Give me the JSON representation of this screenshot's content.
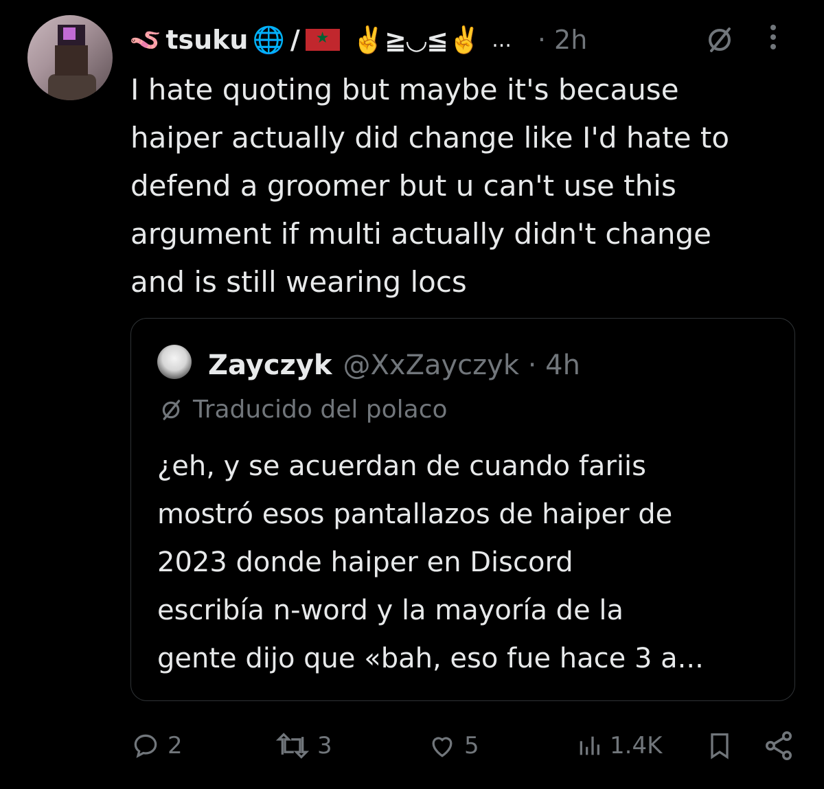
{
  "author": {
    "name_emoji": "🪱",
    "name": "tsuku",
    "globe": "🌐",
    "separator": "/",
    "kaomoji": "✌️≧◡≦✌️",
    "ellipsis": "...",
    "time": "· 2h"
  },
  "tweet": {
    "lines": [
      "I hate quoting but maybe it's because",
      "haiper actually did change like I'd hate to",
      "defend a groomer but u can't use this",
      "argument if multi actually didn't change",
      "and is still wearing locs"
    ]
  },
  "quote": {
    "name": "Zayczyk",
    "handle": "@XxZayczyk · 4h",
    "translated_label": "Traducido del polaco",
    "lines": [
      "¿eh, y se acuerdan de cuando fariis",
      "mostró esos pantallazos de haiper de",
      "2023 donde haiper en Discord",
      "escribía n-word y la mayoría de la",
      "gente dijo que «bah, eso fue hace 3 a..."
    ]
  },
  "actions": {
    "replies": "2",
    "reposts": "3",
    "likes": "5",
    "views": "1.4K"
  },
  "colors": {
    "background": "#000000",
    "text": "#e7e9ea",
    "muted": "#71767b",
    "border": "#2f3336"
  }
}
